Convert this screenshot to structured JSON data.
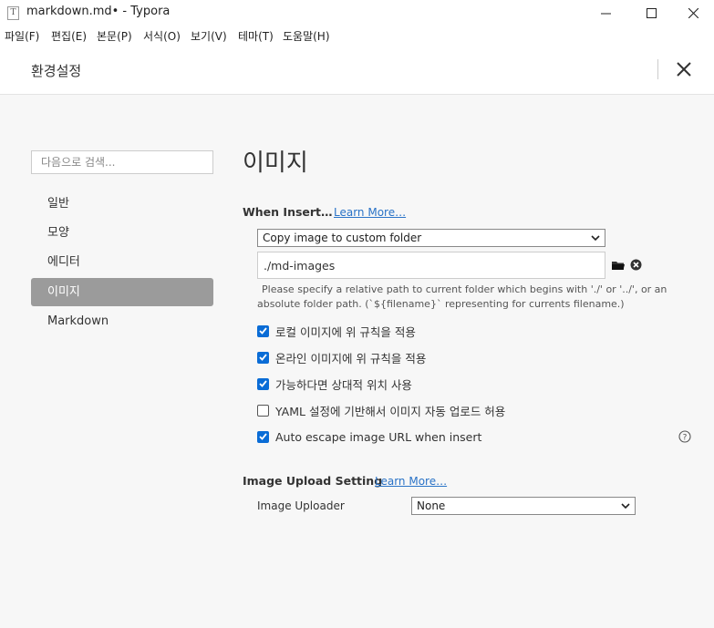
{
  "window": {
    "app_icon": "T",
    "title": "markdown.md• - Typora"
  },
  "menubar": {
    "items": [
      "파일(F)",
      "편집(E)",
      "본문(P)",
      "서식(O)",
      "보기(V)",
      "테마(T)",
      "도움말(H)"
    ]
  },
  "header": {
    "title": "환경설정"
  },
  "sidebar": {
    "search_placeholder": "다음으로 검색...",
    "items": [
      {
        "label": "일반"
      },
      {
        "label": "모양"
      },
      {
        "label": "에디터"
      },
      {
        "label": "이미지",
        "active": true
      },
      {
        "label": "Markdown"
      }
    ]
  },
  "main": {
    "title": "이미지",
    "when_insert": {
      "label": "When Insert…",
      "learn_more": "Learn More…",
      "selected_action": "Copy image to custom folder",
      "path_value": "./md-images",
      "hint_line1": "Please specify a relative path to current folder which begins with './' or '../', or an",
      "hint_line2": "absolute folder path. (`${filename}` representing for currents filename.)"
    },
    "options": [
      {
        "label": "로컬 이미지에 위 규칙을 적용",
        "checked": true
      },
      {
        "label": "온라인 이미지에 위 규칙을 적용",
        "checked": true
      },
      {
        "label": "가능하다면 상대적 위치 사용",
        "checked": true
      },
      {
        "label": "YAML 설정에 기반해서 이미지 자동 업로드 허용",
        "checked": false
      },
      {
        "label": "Auto escape image URL when insert",
        "checked": true
      }
    ],
    "upload": {
      "label": "Image Upload Setting",
      "learn_more": "Learn More…",
      "uploader_label": "Image Uploader",
      "uploader_value": "None"
    }
  },
  "icons": {
    "folder": "folder-icon",
    "clear": "clear-circle-icon",
    "help": "help-circle-icon",
    "dropdown": "chevron-down-icon"
  },
  "colors": {
    "checkbox_accent": "#0a6cd6",
    "link": "#2a73c7",
    "active_nav": "#9b9b9b"
  }
}
